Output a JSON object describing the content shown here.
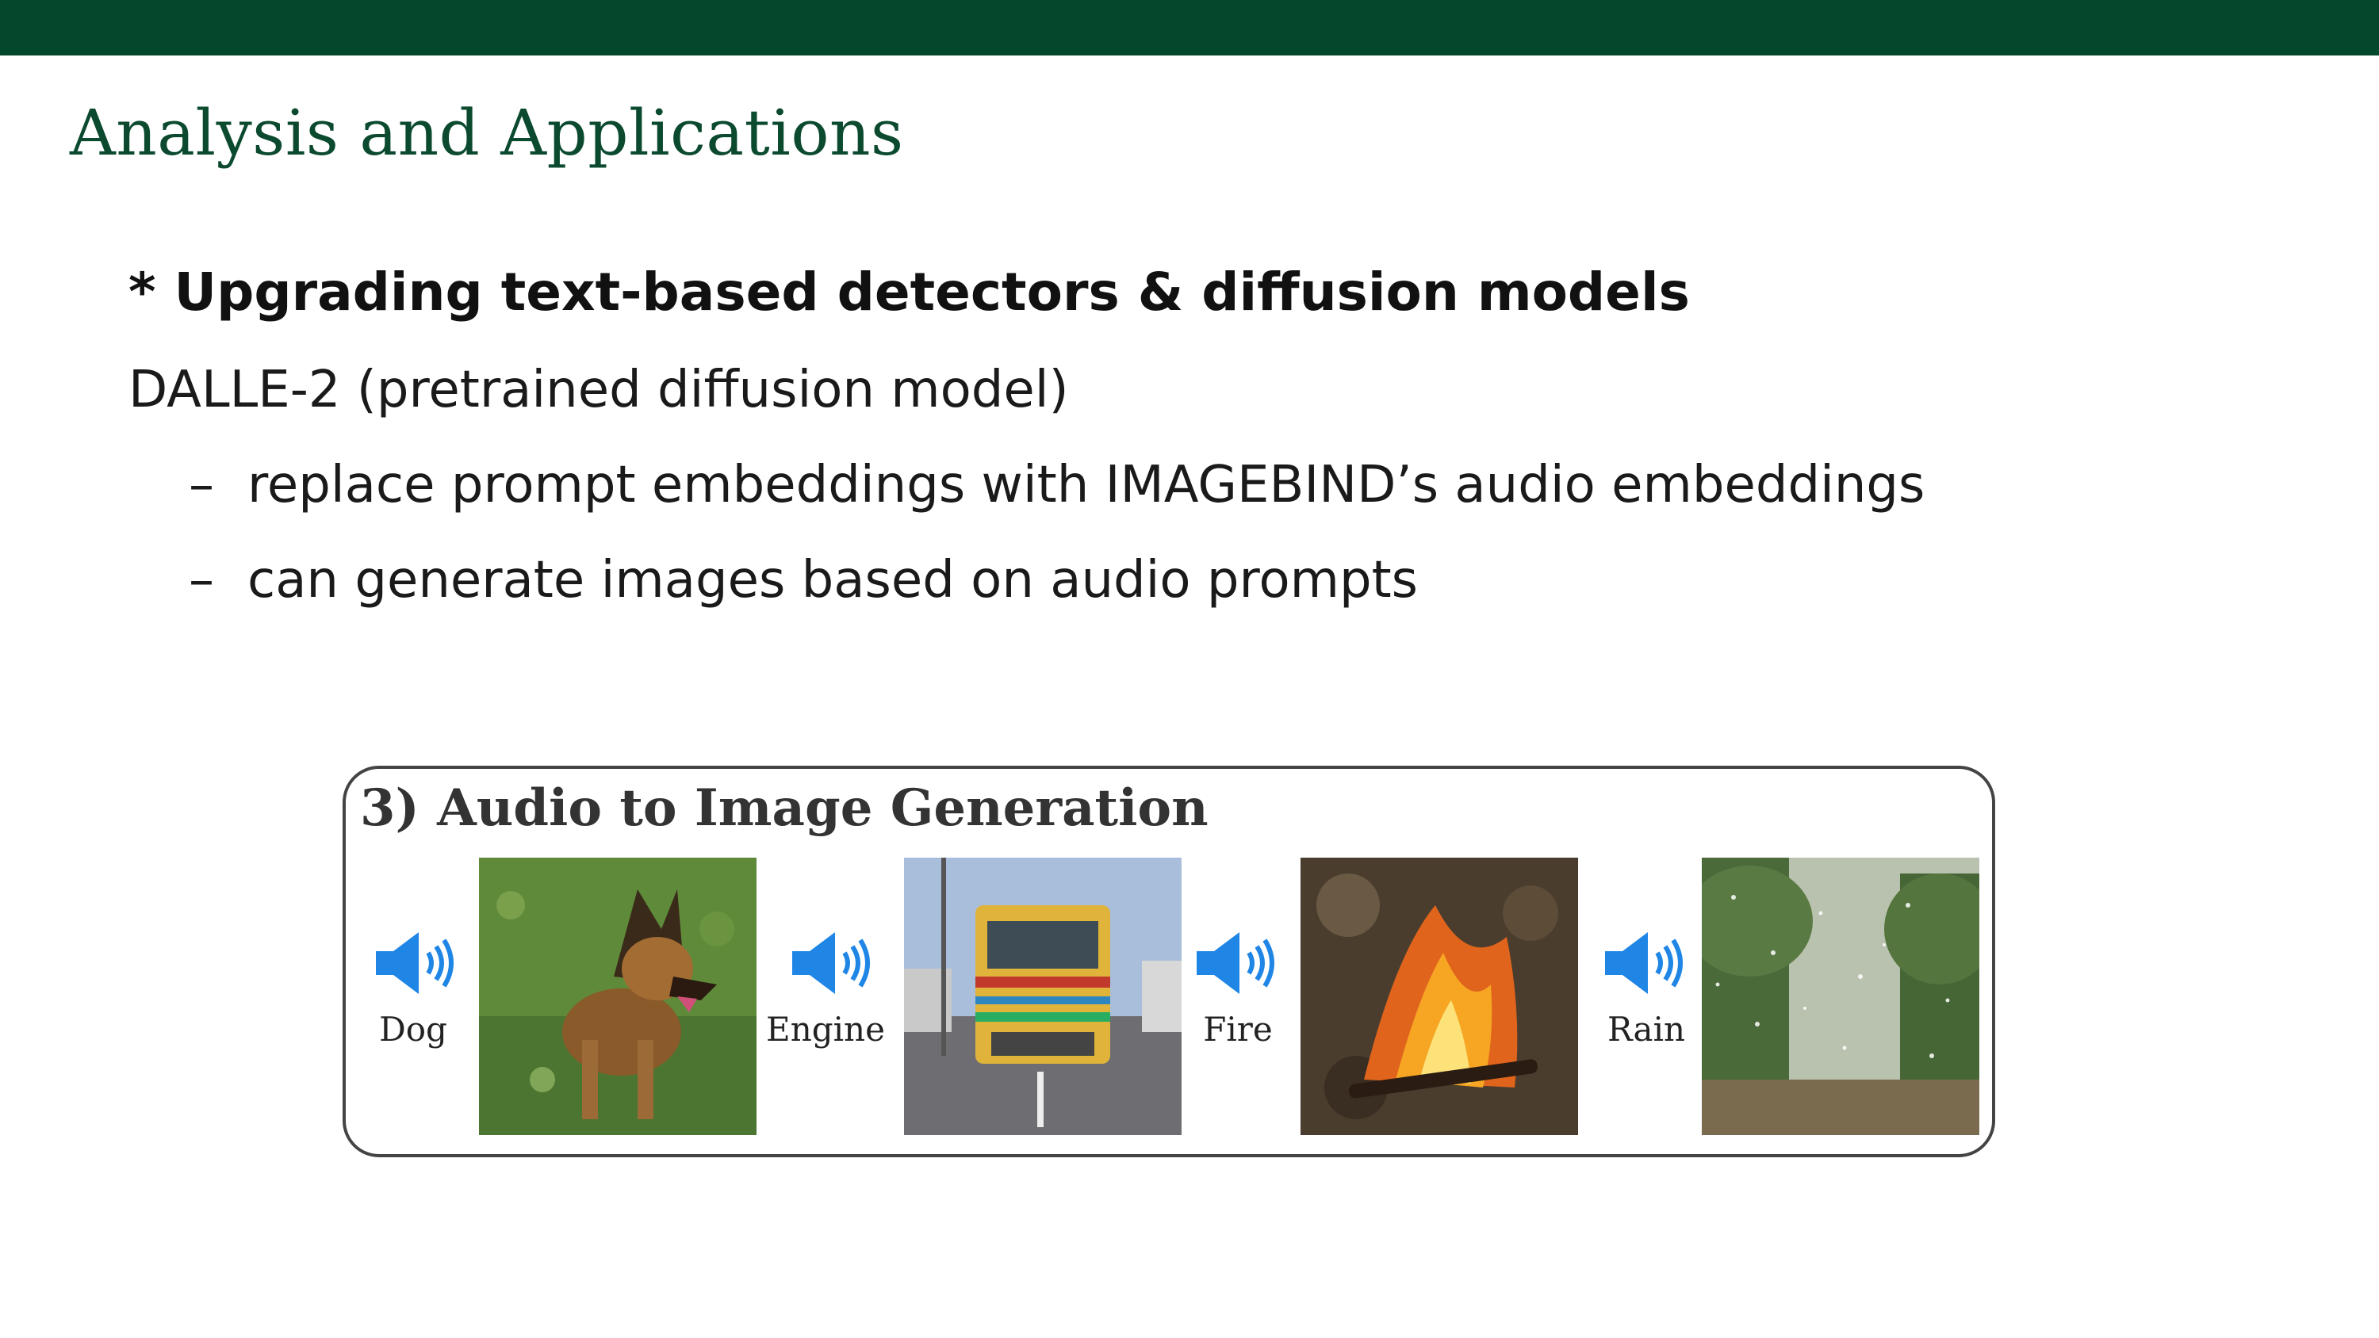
{
  "slide": {
    "title": "Analysis and Applications",
    "heading": "* Upgrading text-based detectors & diffusion models",
    "line1": "DALLE-2 (pretrained diffusion model)",
    "bullets": [
      {
        "dash": "–",
        "text": "replace prompt embeddings with IMAGEBIND’s audio embeddings"
      },
      {
        "dash": "–",
        "text": "can generate images based on audio prompts"
      }
    ]
  },
  "figure": {
    "title": "3) Audio to Image Generation",
    "items": [
      {
        "label": "Dog",
        "icon": "speaker-icon",
        "image": "dog-image"
      },
      {
        "label": "Engine",
        "icon": "speaker-icon",
        "image": "bus-image"
      },
      {
        "label": "Fire",
        "icon": "speaker-icon",
        "image": "fire-image"
      },
      {
        "label": "Rain",
        "icon": "speaker-icon",
        "image": "rain-image"
      }
    ]
  },
  "colors": {
    "brand_green": "#03472c",
    "title_green": "#0b4a2f",
    "speaker_blue": "#1f86e6"
  }
}
